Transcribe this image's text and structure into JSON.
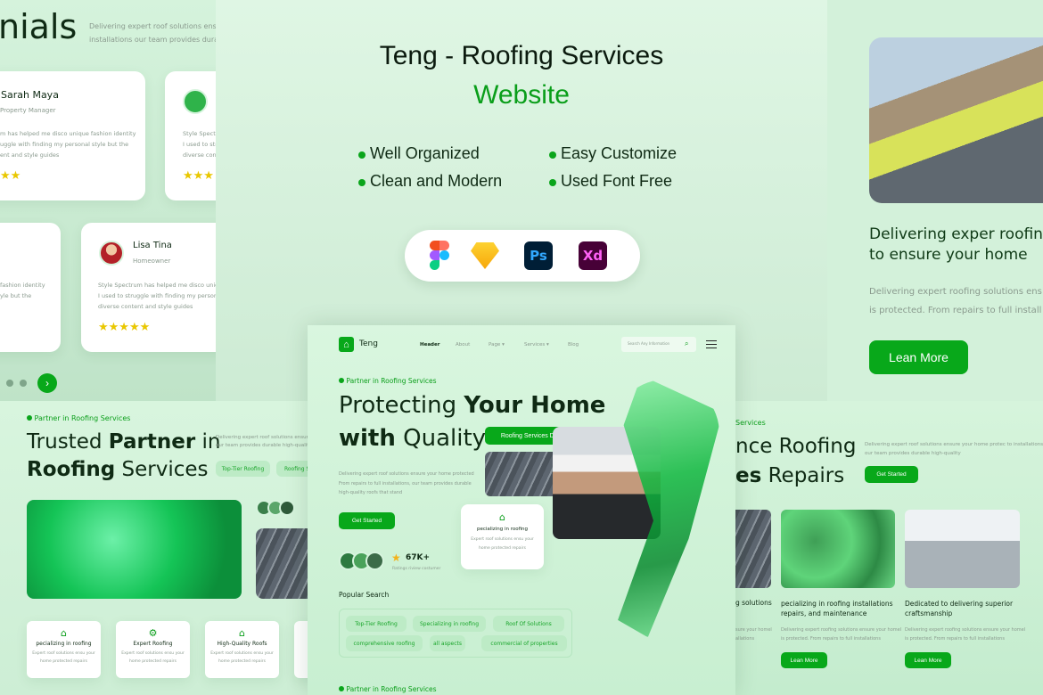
{
  "promo": {
    "title": "Teng - Roofing Services",
    "subtitle": "Website",
    "features": [
      "Well Organized",
      "Easy Customize",
      "Clean and Modern",
      "Used Font Free"
    ],
    "tools": [
      {
        "name": "Figma",
        "label": ""
      },
      {
        "name": "Sketch",
        "label": ""
      },
      {
        "name": "Photoshop",
        "label": "Ps"
      },
      {
        "name": "Adobe XD",
        "label": "Xd"
      }
    ]
  },
  "testimonials": {
    "heading_fragment": "nials",
    "intro": [
      "Delivering expert roof solutions ensure",
      "installations our team provides durabl"
    ],
    "cards": [
      {
        "name": "Sarah Maya",
        "role": "Property Manager",
        "text": [
          "m has helped me disco unique fashion identity",
          "uggle with finding my personal style but the",
          "ent and style guides"
        ],
        "stars": "★★"
      },
      {
        "name": "",
        "role": "",
        "text": [
          "Style Spectr",
          "I used to str",
          "diverse cont"
        ],
        "stars": "★★★"
      },
      {
        "name": "",
        "role": "",
        "text": [
          "fashion identity",
          "yle but the"
        ],
        "stars": ""
      },
      {
        "name": "Lisa Tina",
        "role": "Homeowner",
        "text": [
          "Style Spectrum has helped me disco unique",
          "I used to struggle with finding my personal s",
          "diverse content and style guides"
        ],
        "stars": "★★★★★"
      }
    ],
    "next_icon": "chevron-right-icon"
  },
  "right_top": {
    "heading": [
      "Delivering exper roofing",
      "to ensure your home"
    ],
    "text": [
      "Delivering expert roofing solutions ens",
      "is protected. From repairs to full install"
    ],
    "button": "Lean More"
  },
  "about": {
    "tag": "Partner in Roofing Services",
    "heading_light1": "Trusted ",
    "heading_bold1": "Partner",
    "heading_light2": " in",
    "heading_bold2": "Roofing",
    "heading_light3": " Services",
    "intro": [
      "Delivering expert roof solutions ensure your h",
      "our team provides durable high-quality"
    ],
    "chips": [
      "Top-Tier Roofing",
      "Roofing Se"
    ],
    "features": [
      {
        "title": "pecializing in roofing",
        "text": [
          "Expert roof solutions ensu your",
          "home protected repairs"
        ]
      },
      {
        "title": "Expert Roofing",
        "text": [
          "Expert roof solutions ensu your",
          "home protected repairs"
        ]
      },
      {
        "title": "High-Quality Roofs",
        "text": [
          "Expert roof solutions ensu your",
          "home protected repairs"
        ]
      }
    ]
  },
  "hero": {
    "logo": "Teng",
    "nav": [
      "Header",
      "About",
      "Page",
      "Services",
      "Blog"
    ],
    "search_placeholder": "Search Any Information",
    "tag": "Partner in Roofing Services",
    "heading_light1": "Protecting ",
    "heading_bold1": "Your Home",
    "heading_bold2": "with",
    "heading_light2": " Quality",
    "badge": "Roofing Services Durable",
    "description": [
      "Delivering expert roof solutions ensure your home protected",
      "From repairs to full installations, our team provides durable",
      "high-quality roofs that stand"
    ],
    "cta": "Get Started",
    "rating_value": "67K+",
    "rating_label": "Ratings riview costumer",
    "feature_card": {
      "title": "pecializing in roofing",
      "text": [
        "Expert roof solutions ensu your",
        "home protected repairs"
      ]
    },
    "popular_title": "Popular Search",
    "popular": [
      "Top-Tier Roofing",
      "Specializing in roofing",
      "Roof Of Solutions",
      "comprehensive roofing",
      "all aspects",
      "commercial of properties"
    ],
    "bottom_tag": "Partner in Roofing Services"
  },
  "services": {
    "tag": "Services",
    "heading_line1": "nce Roofing",
    "heading_bold": "es",
    "heading_line2": " Repairs",
    "intro": [
      "Delivering expert roof solutions ensure your home protec to installations",
      "our team provides durable high-quality"
    ],
    "cta": "Get Started",
    "cards": [
      {
        "title": [
          "g solutions",
          ""
        ],
        "text": [
          "sure your homel",
          "allations"
        ],
        "button": ""
      },
      {
        "title": [
          "pecializing in roofing installations",
          "repairs, and maintenance"
        ],
        "text": [
          "Delivering expert roofing solutions ensure your homel",
          "is protected. From repairs to full installations"
        ],
        "button": "Lean More"
      },
      {
        "title": [
          "Dedicated to delivering superior",
          "craftsmanship"
        ],
        "text": [
          "Delivering expert roofing solutions ensure your homel",
          "is protected. From repairs to full installations"
        ],
        "button": "Lean More"
      }
    ]
  },
  "colors": {
    "accent": "#08a81a",
    "background": "#d3f1da",
    "dark": "#0f2a14",
    "star": "#e9c700"
  }
}
